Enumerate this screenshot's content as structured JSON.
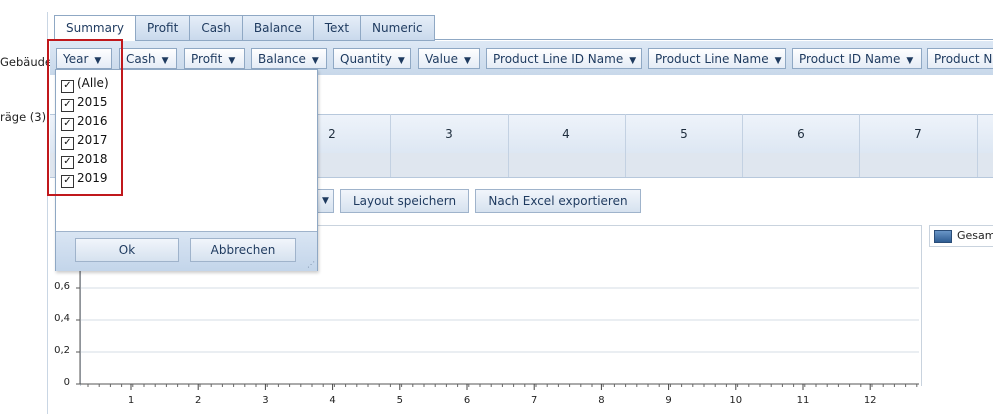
{
  "side_labels": {
    "gebaeude": "Gebäude",
    "eintraege": "räge (3)"
  },
  "tabs": [
    {
      "label": "Summary",
      "active": true
    },
    {
      "label": "Profit"
    },
    {
      "label": "Cash"
    },
    {
      "label": "Balance"
    },
    {
      "label": "Text"
    },
    {
      "label": "Numeric"
    }
  ],
  "fields": [
    "Year",
    "Cash",
    "Profit",
    "Balance",
    "Quantity",
    "Value",
    "Product Line ID Name",
    "Product Line Name",
    "Product ID Name",
    "Product Na"
  ],
  "grid": {
    "columns": [
      "2",
      "3",
      "4",
      "5",
      "6",
      "7"
    ]
  },
  "toolbar": {
    "save_layout": "Layout speichern",
    "export_excel": "Nach Excel exportieren"
  },
  "dropdown": {
    "items": [
      {
        "label": "(Alle)",
        "checked": true
      },
      {
        "label": "2015",
        "checked": true
      },
      {
        "label": "2016",
        "checked": true
      },
      {
        "label": "2017",
        "checked": true
      },
      {
        "label": "2018",
        "checked": true
      },
      {
        "label": "2019",
        "checked": true
      }
    ],
    "ok": "Ok",
    "cancel": "Abbrechen"
  },
  "chart_data": {
    "type": "bar",
    "categories": [
      "1",
      "2",
      "3",
      "4",
      "5",
      "6",
      "7",
      "8",
      "9",
      "10",
      "11",
      "12"
    ],
    "series": [
      {
        "name": "Gesam",
        "values": []
      }
    ],
    "yticks": [
      "0,6",
      "0,4",
      "0,2",
      "0"
    ],
    "ylim": [
      0,
      0.8
    ],
    "grid": true,
    "legend": "top-right",
    "accent_color": "#2f5d93"
  }
}
